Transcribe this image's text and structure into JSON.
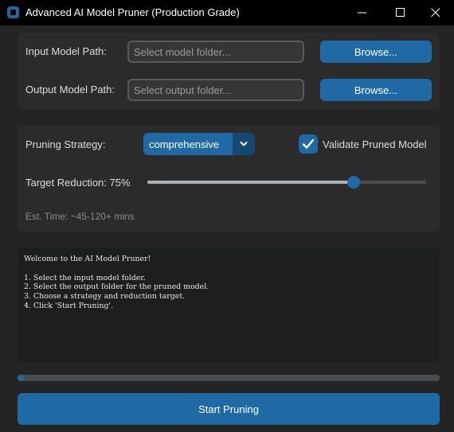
{
  "window": {
    "title": "Advanced AI Model Pruner (Production Grade)"
  },
  "paths": {
    "input_label": "Input Model Path:",
    "input_placeholder": "Select model folder...",
    "input_value": "",
    "input_browse_label": "Browse...",
    "output_label": "Output Model Path:",
    "output_placeholder": "Select output folder...",
    "output_value": "",
    "output_browse_label": "Browse..."
  },
  "settings": {
    "strategy_label": "Pruning Strategy:",
    "strategy_value": "comprehensive",
    "validate_label": "Validate Pruned Model",
    "validate_checked": true,
    "reduction_label": "Target Reduction: 75%",
    "reduction_value": 75,
    "reduction_min": 0,
    "reduction_max": 100,
    "est_time": "Est. Time: ~45-120+ mins"
  },
  "log": {
    "text": "Welcome to the AI Model Pruner!\n\n1. Select the input model folder.\n2. Select the output folder for the pruned model.\n3. Choose a strategy and reduction target.\n4. Click 'Start Pruning'."
  },
  "progress": {
    "fraction": 0.015
  },
  "actions": {
    "start_label": "Start Pruning"
  },
  "colors": {
    "accent": "#1f6aa5",
    "accent_dark": "#144870",
    "window_bg": "#242424",
    "panel_bg": "#2b2b2b",
    "titlebar_bg": "#000000"
  },
  "icons": {
    "app": "app-icon",
    "minimize": "minimize-icon",
    "maximize": "maximize-icon",
    "close": "close-icon",
    "dropdown": "chevron-down-icon",
    "checkbox": "checkmark-icon"
  }
}
